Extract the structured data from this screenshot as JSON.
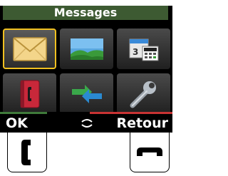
{
  "title": "Messages",
  "menu_items": [
    {
      "icon": "envelope-icon",
      "selected": true
    },
    {
      "icon": "picture-landscape-icon",
      "selected": false
    },
    {
      "icon": "calendar-calculator-icon",
      "selected": false
    },
    {
      "icon": "address-book-icon",
      "selected": false
    },
    {
      "icon": "sync-arrows-icon",
      "selected": false
    },
    {
      "icon": "wrench-settings-icon",
      "selected": false
    }
  ],
  "softkeys": {
    "left": "OK",
    "right": "Retour"
  },
  "hardware_keys": {
    "left": "call-icon",
    "right": "hangup-icon"
  },
  "colors": {
    "title_bar": "#3d5a32",
    "selection": "#f0c020",
    "left_underline": "#3f7a3a",
    "right_underline": "#c83333"
  }
}
